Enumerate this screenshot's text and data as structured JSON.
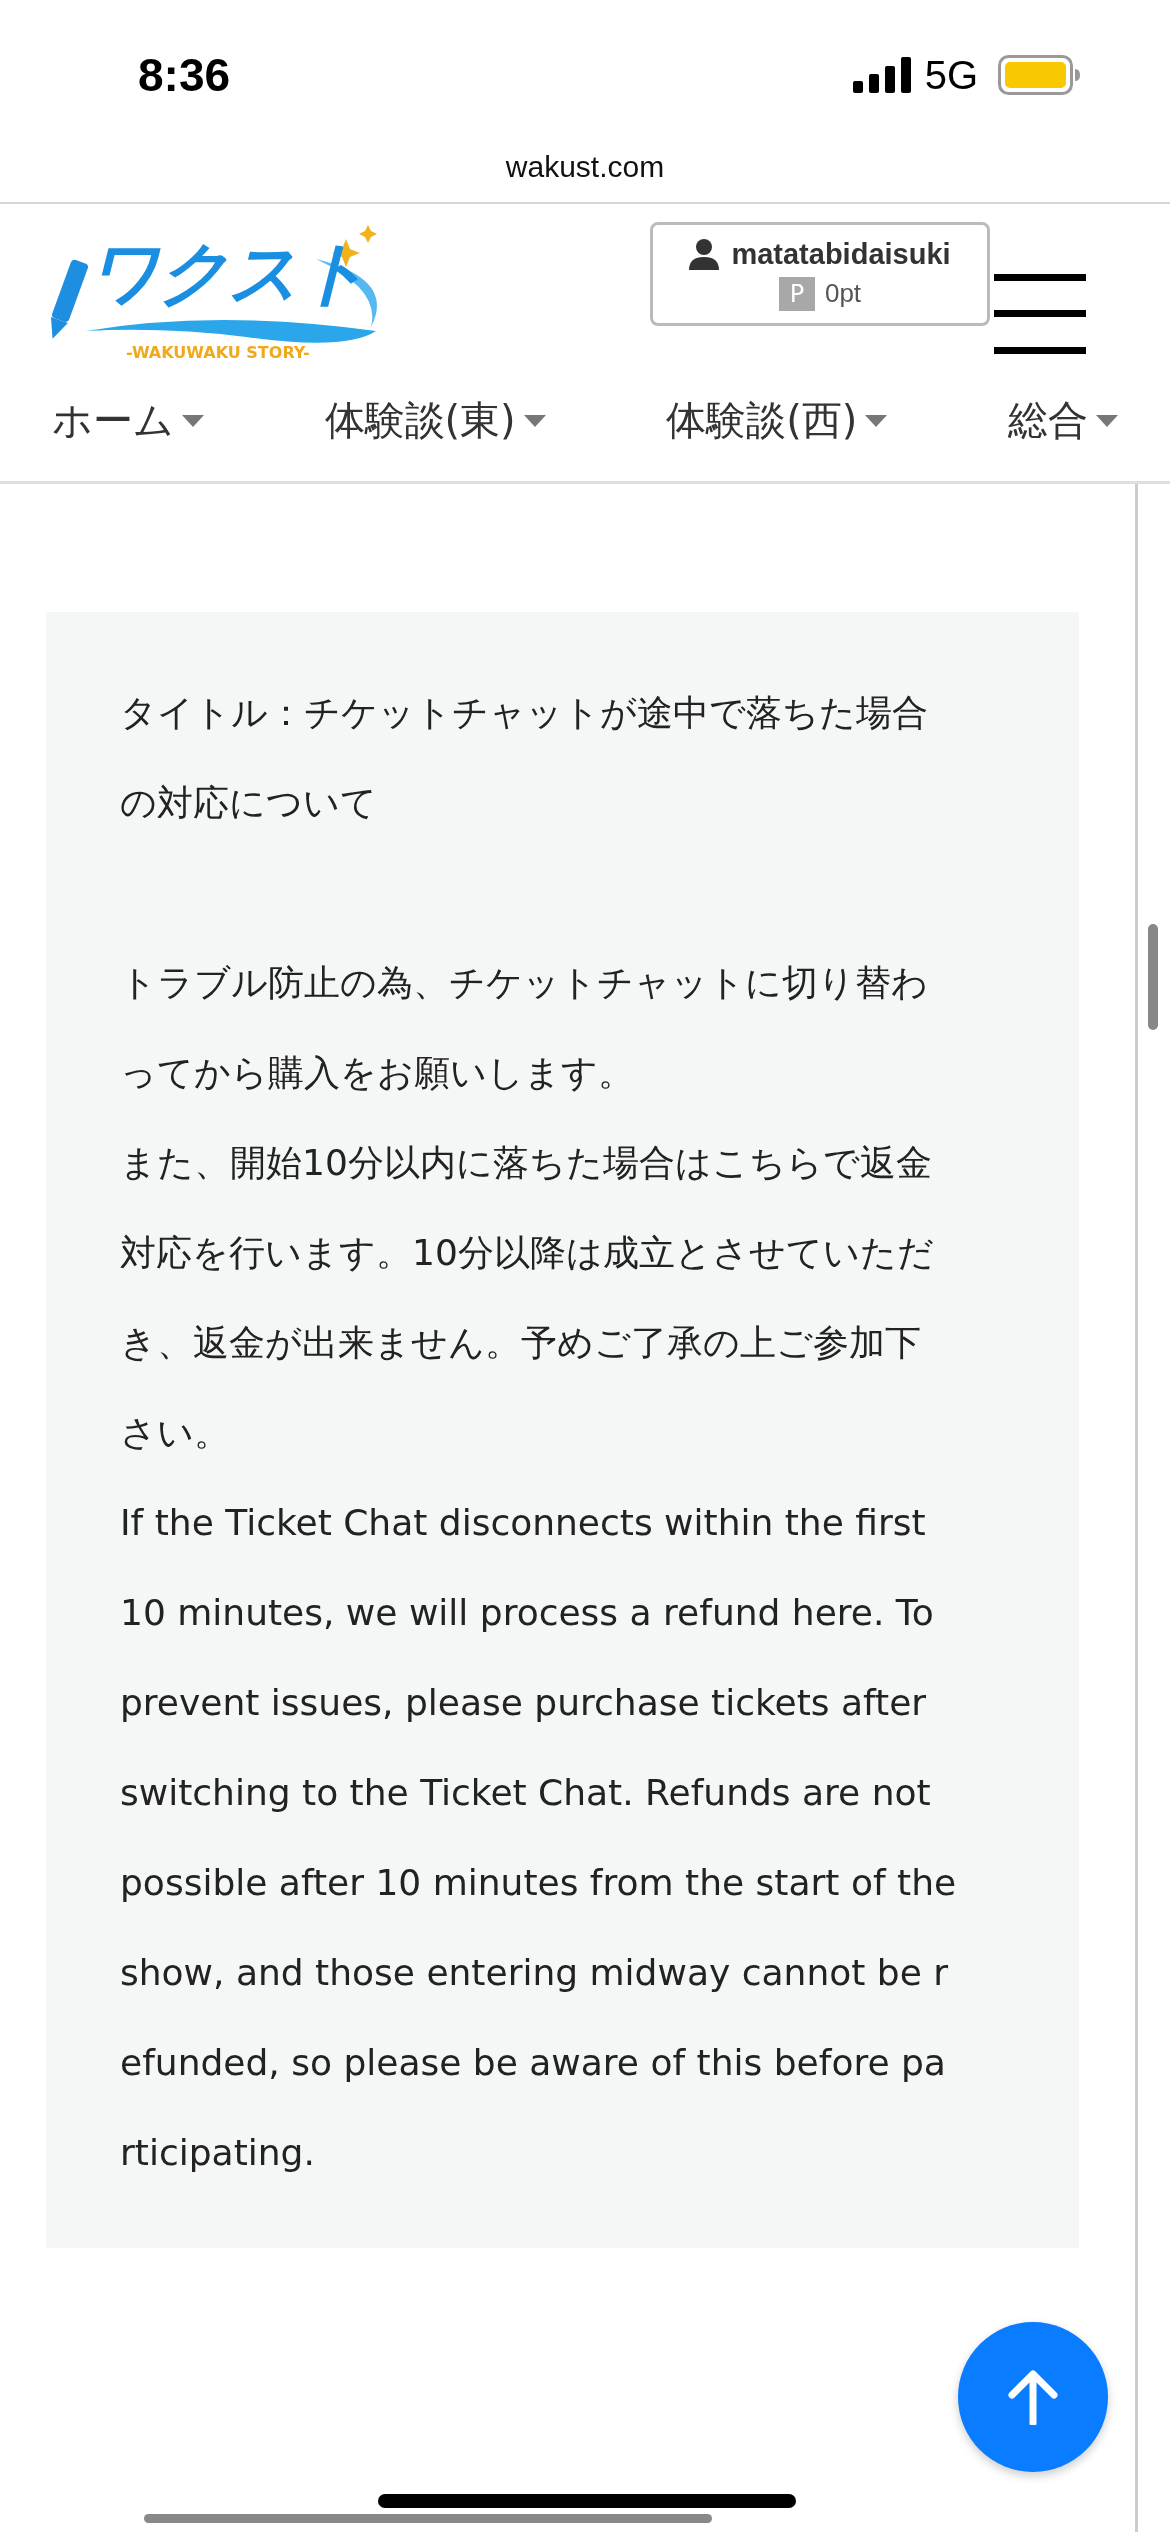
{
  "status_bar": {
    "time": "8:36",
    "network": "5G"
  },
  "browser": {
    "url": "wakust.com"
  },
  "header": {
    "logo": {
      "text": "ワクスト",
      "tagline": "-WAKUWAKU STORY-"
    },
    "user": {
      "name": "matatabidaisuki",
      "points_badge": "P",
      "points": "0pt"
    }
  },
  "nav": [
    {
      "label": "ホーム"
    },
    {
      "label": "体験談(東)"
    },
    {
      "label": "体験談(西)"
    },
    {
      "label": "総合"
    }
  ],
  "notice": {
    "paragraphs": [
      {
        "lines": [
          "タイトル：チケットチャットが途中で落ちた場合",
          "の対応について"
        ]
      },
      {
        "lines": [
          "トラブル防止の為、チケットチャットに切り替わ",
          "ってから購入をお願いします。"
        ]
      },
      {
        "lines": [
          "また、開始10分以内に落ちた場合はこちらで返金",
          "対応を行います。10分以降は成立とさせていただ",
          "き、返金が出来ません。予めご了承の上ご参加下",
          "さい。"
        ]
      },
      {
        "lines": [
          "If the Ticket Chat disconnects within the first",
          "10 minutes, we will process a refund here. To",
          "prevent issues, please purchase tickets after",
          "switching to the Ticket Chat. Refunds are not",
          "possible after 10 minutes from the start of the",
          "show, and those entering midway cannot be r",
          "efunded, so please be aware of this before pa",
          "rticipating."
        ]
      }
    ]
  }
}
